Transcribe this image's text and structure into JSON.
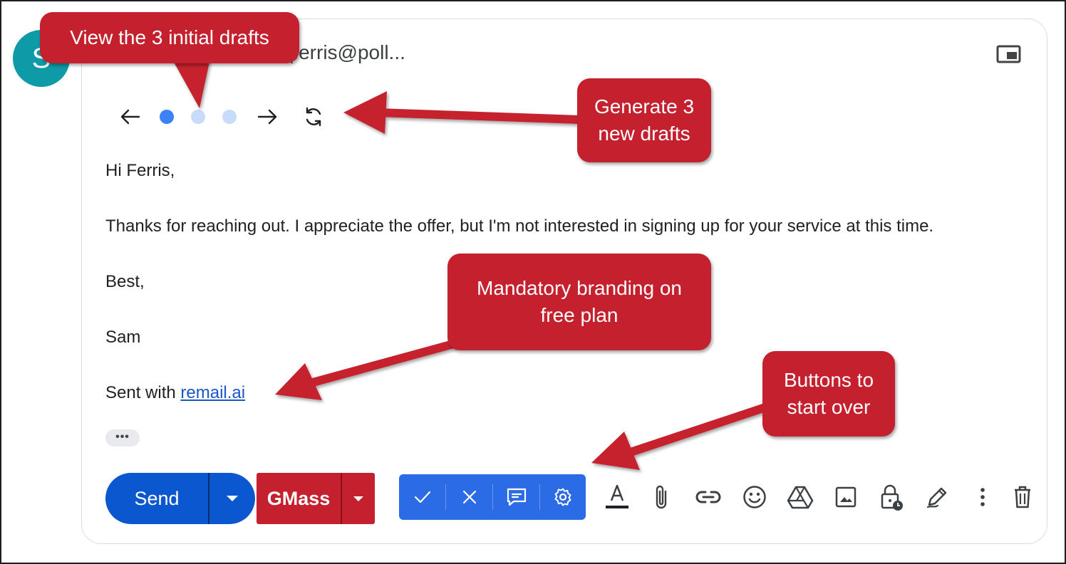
{
  "avatar": {
    "initial": "S",
    "color": "#0e9aa7"
  },
  "compose": {
    "recipient": "(ferris@poll..."
  },
  "draft_nav": {
    "prev_icon": "arrow-left-icon",
    "next_icon": "arrow-right-icon",
    "regenerate_icon": "refresh-icon",
    "drafts_total": 3,
    "active_draft": 1,
    "dot_active_color": "#3b82f6",
    "dot_inactive_color": "#c6dcf8"
  },
  "email_body": {
    "greeting": "Hi Ferris,",
    "paragraph": "Thanks for reaching out. I appreciate the offer, but I'm not interested in signing up for your service at this time.",
    "signoff": "Best,",
    "name": "Sam",
    "branding_prefix": "Sent with ",
    "branding_link": "remail.ai",
    "trimmed_content_label": "•••"
  },
  "toolbar": {
    "send_label": "Send",
    "gmass_label": "GMass",
    "remail_buttons": [
      "check-icon",
      "close-icon",
      "feedback-icon",
      "gear-icon"
    ],
    "tools": [
      "text-format-icon",
      "attachment-icon",
      "link-icon",
      "emoji-icon",
      "drive-icon",
      "image-icon",
      "confidential-mode-icon",
      "signature-icon",
      "more-options-icon",
      "trash-icon"
    ]
  },
  "annotations": {
    "view_drafts": "View the 3 initial drafts",
    "generate": "Generate 3\nnew drafts",
    "branding": "Mandatory branding on\nfree plan",
    "start_over": "Buttons to\nstart over"
  },
  "colors": {
    "send_blue": "#0b57d0",
    "gmass_red": "#c5202d",
    "remail_blue": "#2c6be6",
    "callout_red": "#c5202d"
  }
}
